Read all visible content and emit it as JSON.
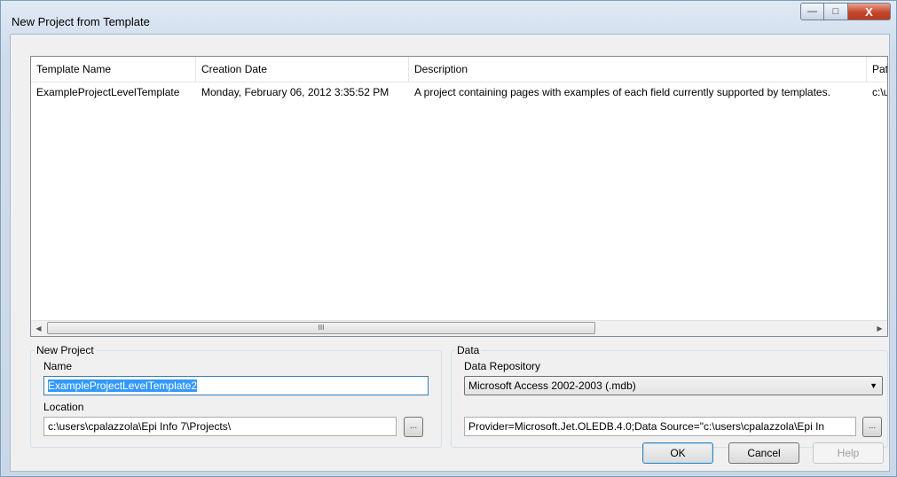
{
  "window": {
    "title": "New Project from Template"
  },
  "window_controls": {
    "minimize": "—",
    "maximize": "□",
    "close": "X"
  },
  "templates": {
    "columns": [
      "Template Name",
      "Creation Date",
      "Description",
      "Path"
    ],
    "rows": [
      {
        "name": "ExampleProjectLevelTemplate",
        "date": "Monday, February 06, 2012 3:35:52 PM",
        "description": "A project containing pages with examples of each field currently supported by templates.",
        "path": "c:\\u"
      }
    ],
    "scrollbar": {
      "left_icon": "scroll-left-icon",
      "right_icon": "scroll-right-icon",
      "thumb_grip": "III"
    }
  },
  "new_project": {
    "legend": "New Project",
    "name_label": "Name",
    "name_value": "ExampleProjectLevelTemplate2",
    "location_label": "Location",
    "location_value": "c:\\users\\cpalazzola\\Epi Info 7\\Projects\\",
    "browse_label": "..."
  },
  "data": {
    "legend": "Data",
    "repository_label": "Data Repository",
    "repository_value": "Microsoft Access 2002-2003 (.mdb)",
    "connection_value": "Provider=Microsoft.Jet.OLEDB.4.0;Data Source=\"c:\\users\\cpalazzola\\Epi In",
    "browse_label": "..."
  },
  "buttons": {
    "ok": "OK",
    "cancel": "Cancel",
    "help": "Help"
  }
}
